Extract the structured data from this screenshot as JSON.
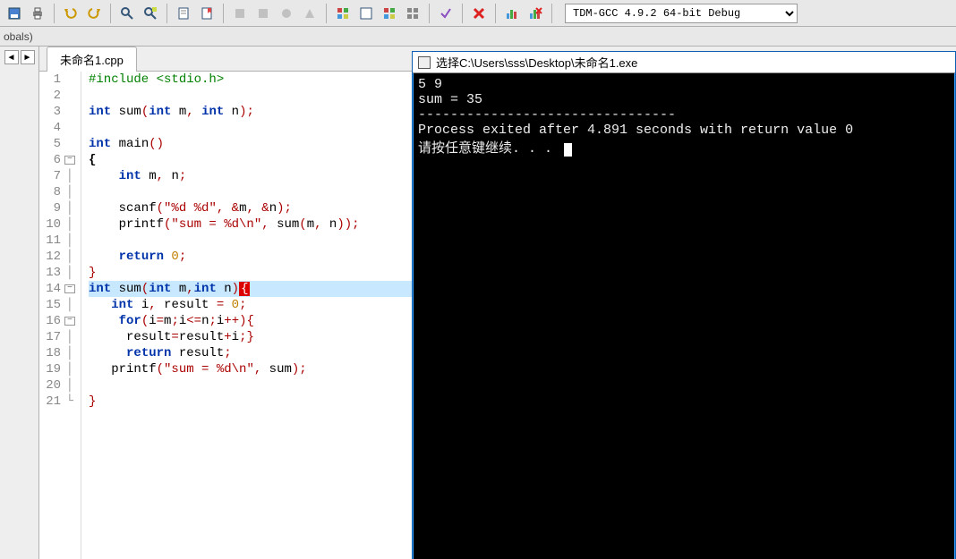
{
  "toolbar": {
    "compiler": "TDM-GCC 4.9.2 64-bit Debug"
  },
  "secbar_label": "obals)",
  "tab_label": "未命名1.cpp",
  "gutter": [
    {
      "n": "1",
      "fold": ""
    },
    {
      "n": "2",
      "fold": ""
    },
    {
      "n": "3",
      "fold": ""
    },
    {
      "n": "4",
      "fold": ""
    },
    {
      "n": "5",
      "fold": ""
    },
    {
      "n": "6",
      "fold": "-"
    },
    {
      "n": "7",
      "fold": "|"
    },
    {
      "n": "8",
      "fold": "|"
    },
    {
      "n": "9",
      "fold": "|"
    },
    {
      "n": "10",
      "fold": "|"
    },
    {
      "n": "11",
      "fold": "|"
    },
    {
      "n": "12",
      "fold": "|"
    },
    {
      "n": "13",
      "fold": "|"
    },
    {
      "n": "14",
      "fold": "-"
    },
    {
      "n": "15",
      "fold": "|"
    },
    {
      "n": "16",
      "fold": "-"
    },
    {
      "n": "17",
      "fold": "|"
    },
    {
      "n": "18",
      "fold": "|"
    },
    {
      "n": "19",
      "fold": "|"
    },
    {
      "n": "20",
      "fold": "|"
    },
    {
      "n": "21",
      "fold": "L"
    }
  ],
  "code": [
    {
      "hl": false,
      "segs": [
        [
          "pp",
          "#include <stdio.h>"
        ]
      ]
    },
    {
      "hl": false,
      "segs": []
    },
    {
      "hl": false,
      "segs": [
        [
          "type",
          "int "
        ],
        [
          "id",
          "sum"
        ],
        [
          "punc",
          "("
        ],
        [
          "type",
          "int "
        ],
        [
          "id",
          "m"
        ],
        [
          "punc",
          ", "
        ],
        [
          "type",
          "int "
        ],
        [
          "id",
          "n"
        ],
        [
          "punc",
          ");"
        ]
      ]
    },
    {
      "hl": false,
      "segs": []
    },
    {
      "hl": false,
      "segs": [
        [
          "type",
          "int "
        ],
        [
          "id",
          "main"
        ],
        [
          "punc",
          "()"
        ]
      ]
    },
    {
      "hl": false,
      "segs": [
        [
          "brace",
          "{"
        ]
      ]
    },
    {
      "hl": false,
      "segs": [
        [
          "id",
          "    "
        ],
        [
          "type",
          "int "
        ],
        [
          "id",
          "m"
        ],
        [
          "punc",
          ", "
        ],
        [
          "id",
          "n"
        ],
        [
          "punc",
          ";"
        ]
      ]
    },
    {
      "hl": false,
      "segs": []
    },
    {
      "hl": false,
      "segs": [
        [
          "id",
          "    scanf"
        ],
        [
          "punc",
          "("
        ],
        [
          "str",
          "\"%d %d\""
        ],
        [
          "punc",
          ", &"
        ],
        [
          "id",
          "m"
        ],
        [
          "punc",
          ", &"
        ],
        [
          "id",
          "n"
        ],
        [
          "punc",
          ");"
        ]
      ]
    },
    {
      "hl": false,
      "segs": [
        [
          "id",
          "    printf"
        ],
        [
          "punc",
          "("
        ],
        [
          "str",
          "\"sum = %d\\n\""
        ],
        [
          "punc",
          ", "
        ],
        [
          "id",
          "sum"
        ],
        [
          "punc",
          "("
        ],
        [
          "id",
          "m"
        ],
        [
          "punc",
          ", "
        ],
        [
          "id",
          "n"
        ],
        [
          "punc",
          "));"
        ]
      ]
    },
    {
      "hl": false,
      "segs": []
    },
    {
      "hl": false,
      "segs": [
        [
          "id",
          "    "
        ],
        [
          "kw",
          "return "
        ],
        [
          "num",
          "0"
        ],
        [
          "punc",
          ";"
        ]
      ]
    },
    {
      "hl": false,
      "segs": [
        [
          "bracecl",
          "}"
        ]
      ]
    },
    {
      "hl": true,
      "segs": [
        [
          "type",
          "int "
        ],
        [
          "id",
          "sum"
        ],
        [
          "punc",
          "("
        ],
        [
          "type",
          "int "
        ],
        [
          "id",
          "m"
        ],
        [
          "punc",
          ","
        ],
        [
          "type",
          "int "
        ],
        [
          "id",
          "n"
        ],
        [
          "punc",
          ")"
        ],
        [
          "redbox",
          "{"
        ]
      ]
    },
    {
      "hl": false,
      "segs": [
        [
          "id",
          "   "
        ],
        [
          "type",
          "int "
        ],
        [
          "id",
          "i"
        ],
        [
          "punc",
          ", "
        ],
        [
          "id",
          "result "
        ],
        [
          "punc",
          "= "
        ],
        [
          "num",
          "0"
        ],
        [
          "punc",
          ";"
        ]
      ]
    },
    {
      "hl": false,
      "segs": [
        [
          "id",
          "    "
        ],
        [
          "kw",
          "for"
        ],
        [
          "punc",
          "("
        ],
        [
          "id",
          "i"
        ],
        [
          "punc",
          "="
        ],
        [
          "id",
          "m"
        ],
        [
          "punc",
          ";"
        ],
        [
          "id",
          "i"
        ],
        [
          "punc",
          "<="
        ],
        [
          "id",
          "n"
        ],
        [
          "punc",
          ";"
        ],
        [
          "id",
          "i"
        ],
        [
          "punc",
          "++){"
        ]
      ]
    },
    {
      "hl": false,
      "segs": [
        [
          "id",
          "     result"
        ],
        [
          "punc",
          "="
        ],
        [
          "id",
          "result"
        ],
        [
          "punc",
          "+"
        ],
        [
          "id",
          "i"
        ],
        [
          "punc",
          ";}"
        ]
      ]
    },
    {
      "hl": false,
      "segs": [
        [
          "id",
          "     "
        ],
        [
          "kw",
          "return "
        ],
        [
          "id",
          "result"
        ],
        [
          "punc",
          ";"
        ]
      ]
    },
    {
      "hl": false,
      "segs": [
        [
          "id",
          "   printf"
        ],
        [
          "punc",
          "("
        ],
        [
          "str",
          "\"sum = %d\\n\""
        ],
        [
          "punc",
          ", "
        ],
        [
          "id",
          "sum"
        ],
        [
          "punc",
          ");"
        ]
      ]
    },
    {
      "hl": false,
      "segs": []
    },
    {
      "hl": false,
      "segs": [
        [
          "bracecl",
          "}"
        ]
      ]
    }
  ],
  "console": {
    "title": "选择C:\\Users\\sss\\Desktop\\未命名1.exe",
    "lines": [
      "5 9",
      "sum = 35",
      "",
      "--------------------------------",
      "Process exited after 4.891 seconds with return value 0",
      "请按任意键继续. . . "
    ]
  }
}
